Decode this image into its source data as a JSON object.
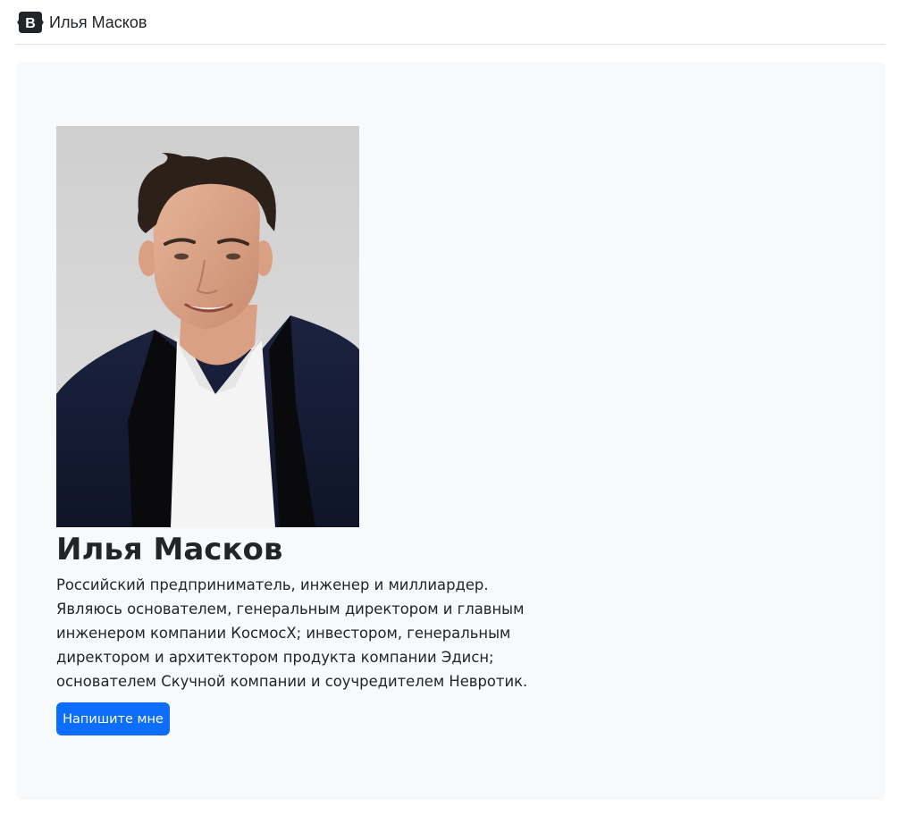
{
  "header": {
    "logo_icon": "bootstrap-logo-icon",
    "brand_name": "Илья Масков"
  },
  "profile": {
    "photo_icon": "portrait-photo",
    "name": "Илья Масков",
    "bio": "Российский предприниматель, инженер и миллиардер. Являюсь основателем, генеральным директором и главным инженером компании КосмосX; инвестором, генеральным директором и архитектором продукта компании Эдисн; основателем Скучной компании и соучредителем Невротик.",
    "cta_label": "Напишите мне"
  },
  "colors": {
    "primary": "#0d6efd",
    "jumbotron_bg": "#f8f9fa",
    "text": "#212529",
    "logo": "#212529"
  }
}
